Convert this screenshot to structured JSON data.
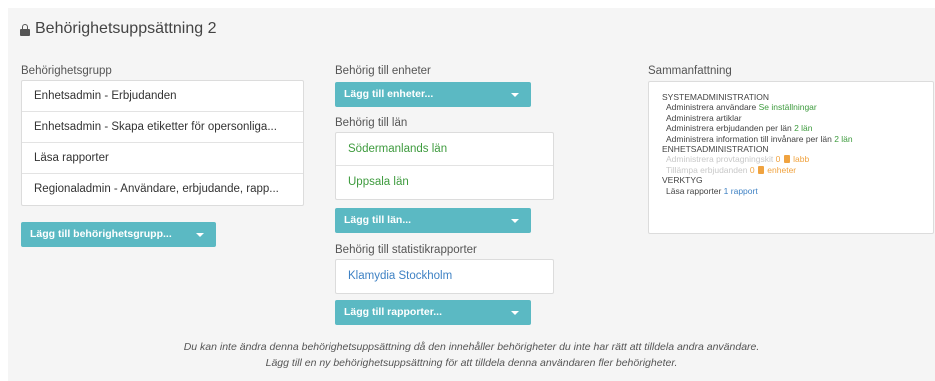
{
  "title": "Behörighetsuppsättning 2",
  "groups": {
    "label": "Behörighetsgrupp",
    "items": [
      "Enhetsadmin - Erbjudanden",
      "Enhetsadmin - Skapa etiketter för opersonliga...",
      "Läsa rapporter",
      "Regionaladmin - Användare, erbjudande, rapp..."
    ],
    "add_button": "Lägg till behörighetsgrupp..."
  },
  "units": {
    "label": "Behörig till enheter",
    "add_button": "Lägg till enheter..."
  },
  "regions": {
    "label": "Behörig till län",
    "items": [
      "Södermanlands län",
      "Uppsala län"
    ],
    "add_button": "Lägg till län..."
  },
  "reports": {
    "label": "Behörig till statistikrapporter",
    "items": [
      "Klamydia Stockholm"
    ],
    "add_button": "Lägg till rapporter..."
  },
  "summary": {
    "label": "Sammanfattning",
    "sec1": "SYSTEMADMINISTRATION",
    "s1_i1": "Administrera användare",
    "s1_i1_link": "Se inställningar",
    "s1_i2": "Administrera artiklar",
    "s1_i3": "Administrera erbjudanden per län",
    "s1_i3_link": "2 län",
    "s1_i4": "Administrera information till invånare per län",
    "s1_i4_link": "2 län",
    "sec2": "ENHETSADMINISTRATION",
    "s2_i1": "Administrera provtagningskit",
    "s2_i1_count": "0",
    "s2_i1_unit": "labb",
    "s2_i2": "Tillämpa erbjudanden",
    "s2_i2_count": "0",
    "s2_i2_unit": "enheter",
    "sec3": "VERKTYG",
    "s3_i1": "Läsa rapporter",
    "s3_i1_link": "1 rapport"
  },
  "notice": {
    "line1": "Du kan inte ändra denna behörighetsuppsättning då den innehåller behörigheter du inte har rätt att tilldela andra användare.",
    "line2": "Lägg till en ny behörighetsuppsättning för att tilldela denna användaren fler behörigheter."
  },
  "colors": {
    "accent": "#5bb9c3",
    "green": "#3e9b3e",
    "blue": "#3f82c4",
    "orange": "#f0a340"
  }
}
